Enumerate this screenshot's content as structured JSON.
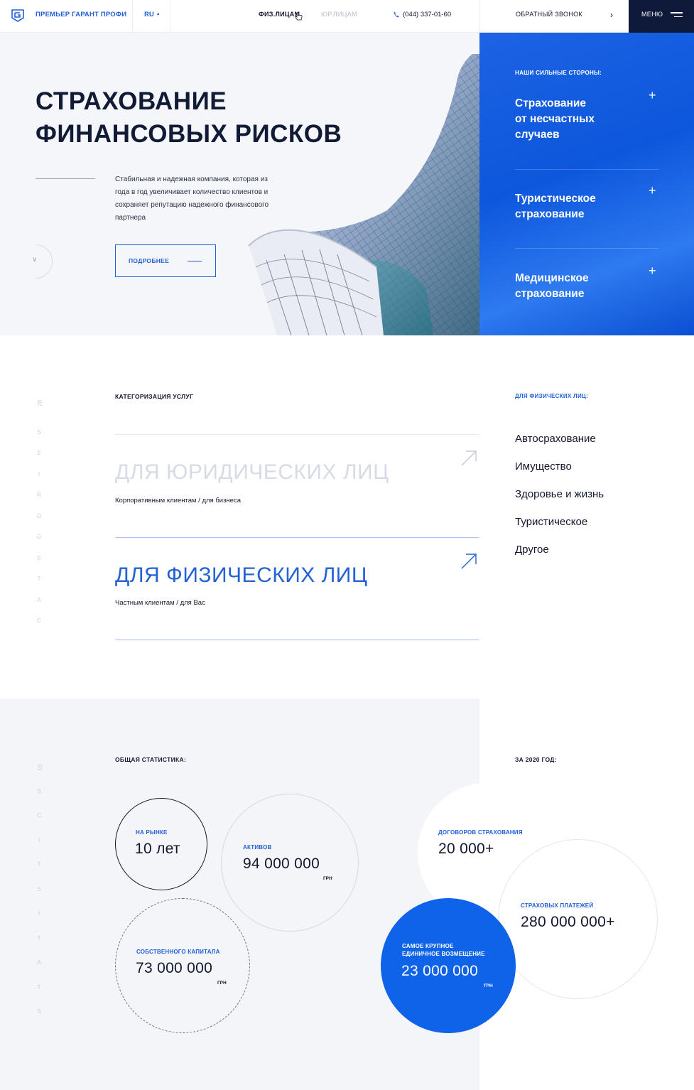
{
  "header": {
    "brand": "ПРЕМЬЕР ГАРАНТ ПРОФИ",
    "lang": "RU",
    "nav_individuals": "ФИЗ.ЛИЦАМ",
    "nav_companies": "ЮР.ЛИЦАМ",
    "phone": "(044) 337-01-60",
    "callback": "ОБРАТНЫЙ ЗВОНОК",
    "menu": "МЕНЮ"
  },
  "hero": {
    "title_line1": "СТРАХОВАНИЕ",
    "title_line2": "ФИНАНСОВЫХ РИСКОВ",
    "description": "Стабильная и надежная компания, которая из года в год увеличивает количество клиентов и сохраняет репутацию надежного финансового партнера",
    "more_button": "ПОДРОБНЕЕ"
  },
  "strengths": {
    "caption": "НАШИ СИЛЬНЫЕ СТОРОНЫ:",
    "items": [
      {
        "line1": "Страхование",
        "line2": "от несчастных",
        "line3": "случаев"
      },
      {
        "line1": "Туристическое",
        "line2": "страхование"
      },
      {
        "line1": "Медицинское",
        "line2": "страхование"
      }
    ]
  },
  "categories": {
    "number": "02",
    "vertical": [
      "S",
      "E",
      "I",
      "R",
      "O",
      "G",
      "E",
      "T",
      "A",
      "C"
    ],
    "label": "КАТЕГОРИЗАЦИЯ УСЛУГ",
    "legal_title": "ДЛЯ ЮРИДИЧЕСКИХ ЛИЦ",
    "legal_sub": "Корпоративным клиентам / для бизнеса",
    "phys_title": "ДЛЯ ФИЗИЧЕСКИХ ЛИЦ",
    "phys_sub": "Частным клиентам / для Вас",
    "phys_list_label": "ДЛЯ ФИЗИЧЕСКИХ ЛИЦ:",
    "phys_list": [
      "Автосрахование",
      "Имущество",
      "Здоровье и жизнь",
      "Туристическое",
      "Другое"
    ]
  },
  "stats": {
    "number": "03",
    "vertical": [
      "S",
      "C",
      "I",
      "T",
      "S",
      "I",
      "T",
      "A",
      "T",
      "S"
    ],
    "label": "ОБЩАЯ СТАТИСТИКА:",
    "year_label": "ЗА 2020 ГОД:",
    "market_label": "НА РЫНКЕ",
    "market_value": "10 лет",
    "assets_label": "АКТИВОВ",
    "assets_value": "94 000 000",
    "assets_unit": "ГРН",
    "equity_label": "СОБСТВЕННОГО КАПИТАЛА",
    "equity_value": "73 000 000",
    "equity_unit": "ГРН",
    "contracts_label": "ДОГОВОРОВ СТРАХОВАНИЯ",
    "contracts_value": "20 000+",
    "payments_label": "СТРАХОВЫХ ПЛАТЕЖЕЙ",
    "payments_value": "280 000 000+",
    "largest_label_line1": "САМОЕ КРУПНОЕ",
    "largest_label_line2": "ЕДИНИЧНОЕ ВОЗМЕЩЕНИЕ",
    "largest_value": "23 000 000",
    "largest_unit": "ГРН"
  },
  "colors": {
    "brand_blue": "#2361d6",
    "dark_navy": "#0f1a3a",
    "text": "#14182e",
    "muted": "#c9ced9"
  }
}
